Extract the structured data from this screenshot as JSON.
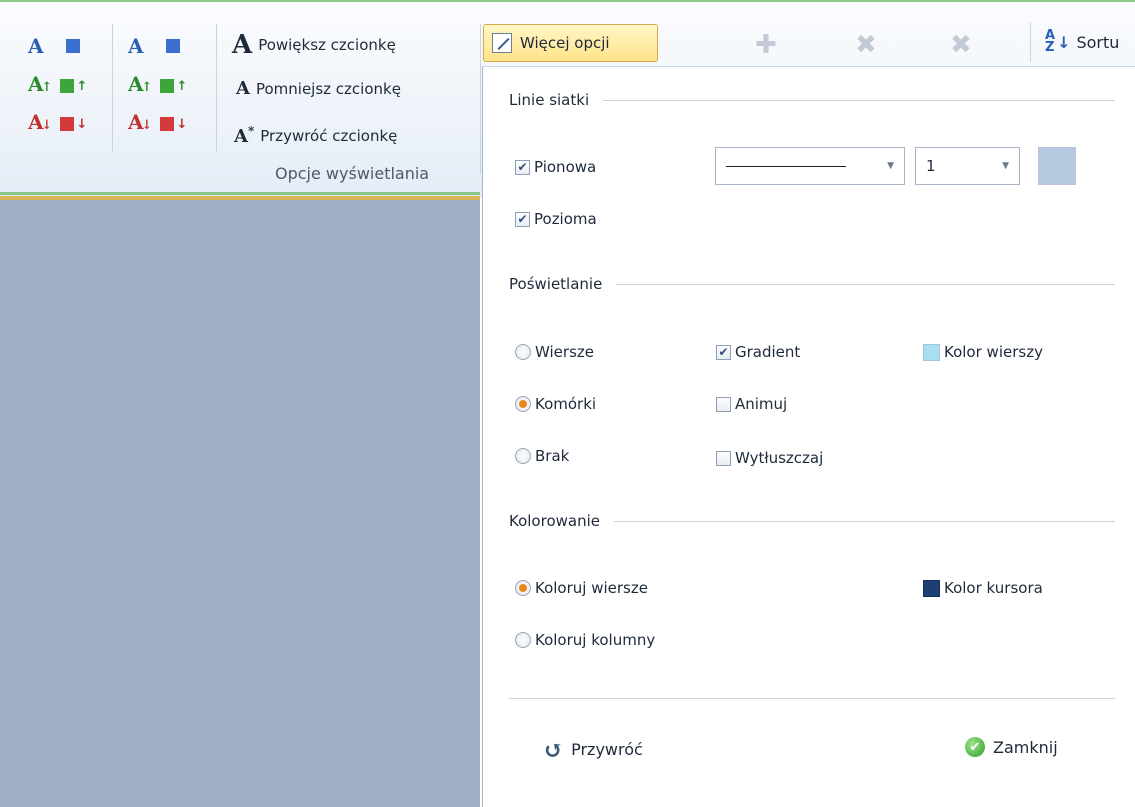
{
  "ribbon": {
    "font_buttons": [
      {
        "glyph": "A",
        "arrow": "",
        "color": "#2a5fb6"
      },
      {
        "glyph": "A",
        "arrow": "↑",
        "color": "#2a8a2a"
      },
      {
        "glyph": "A",
        "arrow": "↓",
        "color": "#c0302e"
      }
    ],
    "commands": {
      "increase_font": "Powiększ czcionkę",
      "decrease_font": "Pomniejsz czcionkę",
      "reset_font": "Przywróć czcionkę"
    },
    "group_label": "Opcje wyświetlania",
    "more_options": "Więcej opcji",
    "sort_label": "Sortu"
  },
  "panel": {
    "gridlines": {
      "title": "Linie siatki",
      "vertical": {
        "label": "Pionowa",
        "checked": true
      },
      "horizontal": {
        "label": "Pozioma",
        "checked": true
      },
      "line_style": "solid",
      "width_value": "1",
      "color": "#b7c9e0"
    },
    "highlight": {
      "title": "Poświetlanie",
      "rows": {
        "label": "Wiersze",
        "selected": false
      },
      "cells": {
        "label": "Komórki",
        "selected": true
      },
      "none": {
        "label": "Brak",
        "selected": false
      },
      "gradient": {
        "label": "Gradient",
        "checked": true
      },
      "animate": {
        "label": "Animuj",
        "checked": false
      },
      "bold": {
        "label": "Wytłuszczaj",
        "checked": false
      },
      "row_color": {
        "label": "Kolor wierszy",
        "color": "#a9ddf2"
      }
    },
    "coloring": {
      "title": "Kolorowanie",
      "color_rows": {
        "label": "Koloruj wiersze",
        "selected": true
      },
      "color_columns": {
        "label": "Koloruj kolumny",
        "selected": false
      },
      "cursor_color": {
        "label": "Kolor kursora",
        "color": "#1f3f73"
      }
    },
    "footer": {
      "restore": "Przywróć",
      "close": "Zamknij"
    }
  }
}
